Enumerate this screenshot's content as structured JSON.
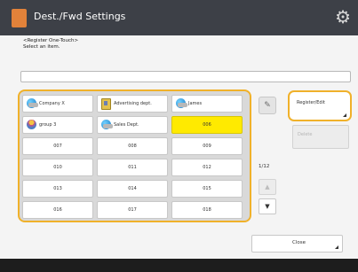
{
  "header": {
    "title": "Dest./Fwd Settings"
  },
  "instructions": {
    "line1": "<Register One-Touch>",
    "line2": "Select an item."
  },
  "search": {
    "value": ""
  },
  "onetouch": {
    "items": [
      {
        "label": "Company X",
        "icon": "globe-icon",
        "selected": false
      },
      {
        "label": "Advertising dept.",
        "icon": "address-book-icon",
        "selected": false
      },
      {
        "label": "James",
        "icon": "globe-icon",
        "selected": false
      },
      {
        "label": "group 3",
        "icon": "group-icon",
        "selected": false
      },
      {
        "label": "Sales Dept.",
        "icon": "globe-icon",
        "selected": false
      },
      {
        "label": "006",
        "icon": "",
        "selected": true
      },
      {
        "label": "007",
        "icon": "",
        "selected": false
      },
      {
        "label": "008",
        "icon": "",
        "selected": false
      },
      {
        "label": "009",
        "icon": "",
        "selected": false
      },
      {
        "label": "010",
        "icon": "",
        "selected": false
      },
      {
        "label": "011",
        "icon": "",
        "selected": false
      },
      {
        "label": "012",
        "icon": "",
        "selected": false
      },
      {
        "label": "013",
        "icon": "",
        "selected": false
      },
      {
        "label": "014",
        "icon": "",
        "selected": false
      },
      {
        "label": "015",
        "icon": "",
        "selected": false
      },
      {
        "label": "016",
        "icon": "",
        "selected": false
      },
      {
        "label": "017",
        "icon": "",
        "selected": false
      },
      {
        "label": "018",
        "icon": "",
        "selected": false
      }
    ]
  },
  "actions": {
    "register_label": "Register/Edit",
    "delete_label": "Delete",
    "close_label": "Close"
  },
  "pager": {
    "indicator": "1/12"
  },
  "colors": {
    "accent": "#f0b12a",
    "selected": "#ffea00",
    "titlebar": "#3d4047"
  }
}
